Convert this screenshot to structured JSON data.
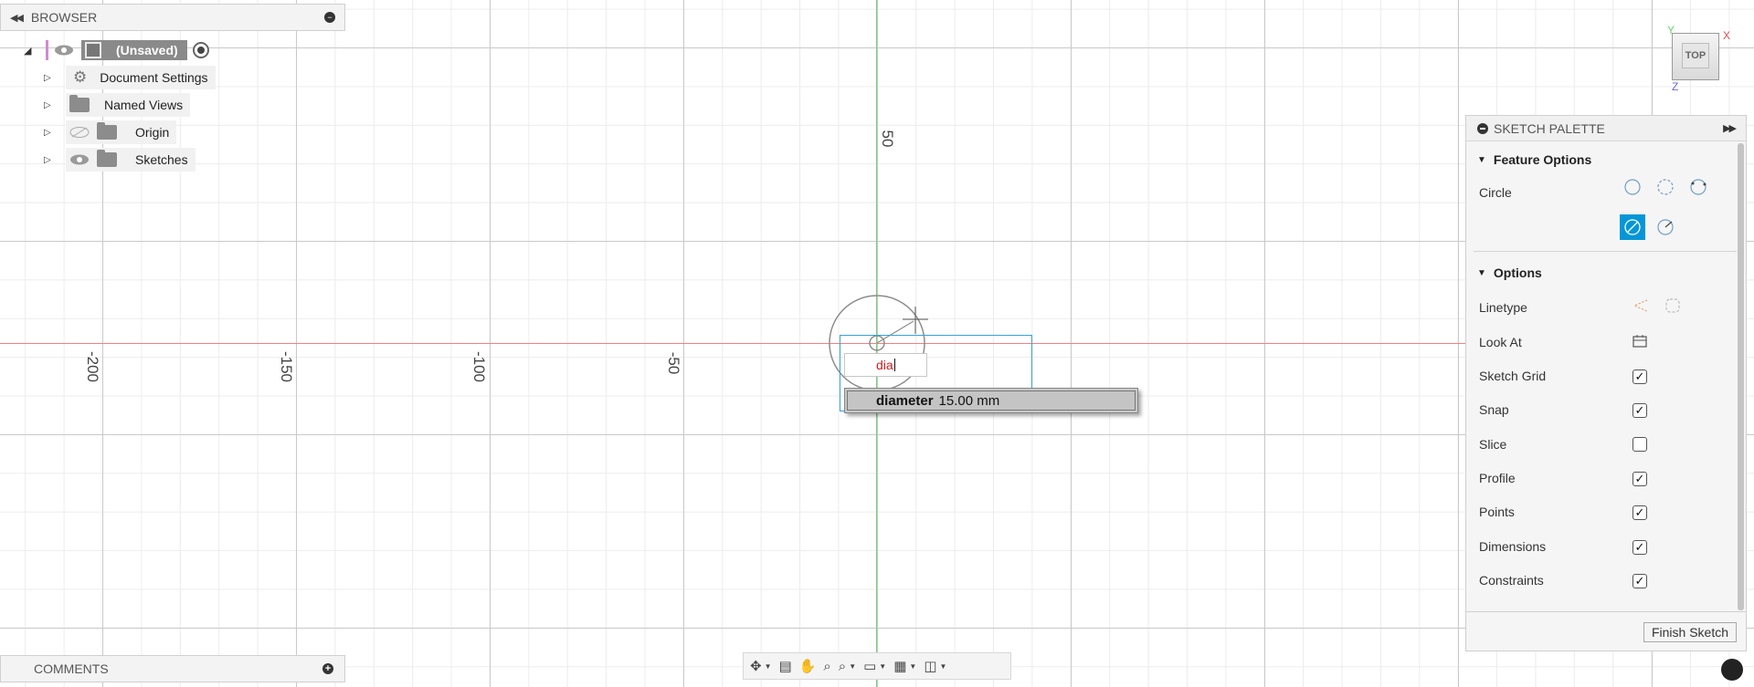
{
  "browser": {
    "title": "BROWSER",
    "root": {
      "label": "(Unsaved)"
    },
    "items": [
      {
        "label": "Document Settings",
        "icon": "gear-icon"
      },
      {
        "label": "Named Views",
        "icon": "folder-icon"
      },
      {
        "label": "Origin",
        "icon": "folder-icon",
        "visibility": "hidden"
      },
      {
        "label": "Sketches",
        "icon": "folder-icon",
        "visibility": "visible"
      }
    ]
  },
  "canvas": {
    "tick_labels": [
      "-200",
      "-150",
      "-100",
      "-50",
      "50"
    ],
    "axis_colors": {
      "x": "#ff7b7b",
      "y": "#6fd46f"
    }
  },
  "viewcube": {
    "face": "TOP",
    "axes": {
      "x": "X",
      "y": "Y",
      "z": "Z"
    }
  },
  "sketch_input": {
    "typed": "dia",
    "suggestion_name": "diameter",
    "suggestion_value": "15.00 mm"
  },
  "palette": {
    "title": "SKETCH PALETTE",
    "feature_options_title": "Feature Options",
    "circle_label": "Circle",
    "options_title": "Options",
    "options": [
      {
        "label": "Linetype"
      },
      {
        "label": "Look At"
      },
      {
        "label": "Sketch Grid",
        "checked": true
      },
      {
        "label": "Snap",
        "checked": true
      },
      {
        "label": "Slice",
        "checked": false
      },
      {
        "label": "Profile",
        "checked": true
      },
      {
        "label": "Points",
        "checked": true
      },
      {
        "label": "Dimensions",
        "checked": true
      },
      {
        "label": "Constraints",
        "checked": true
      }
    ],
    "finish_label": "Finish Sketch",
    "accent": "#0696d7"
  },
  "comments": {
    "title": "COMMENTS"
  }
}
